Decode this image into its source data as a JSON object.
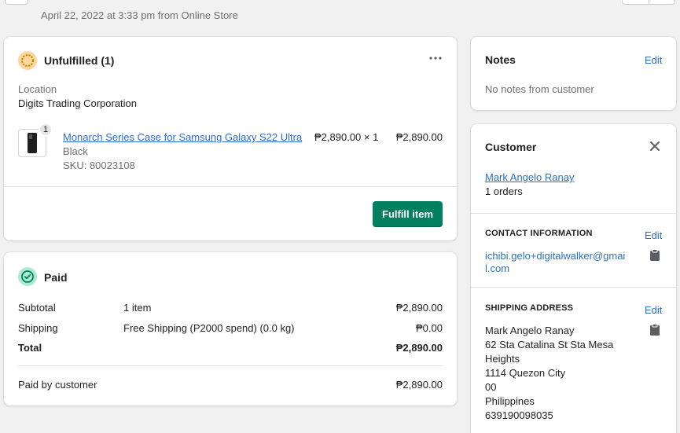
{
  "header": {
    "subtitle": "April 22, 2022 at 3:33 pm from Online Store"
  },
  "fulfillment": {
    "title": "Unfulfilled (1)",
    "more_icon": "more-horizontal-icon",
    "location_label": "Location",
    "location_value": "Digits Trading Corporation",
    "item": {
      "quantity_badge": "1",
      "name": "Monarch Series Case for Samsung Galaxy S22 Ultra",
      "variant": "Black",
      "sku": "SKU: 80023108",
      "unit_price": "₱2,890.00 × 1",
      "line_total": "₱2,890.00"
    },
    "fulfill_button": "Fulfill item",
    "status_color": "#ffd79d"
  },
  "payment": {
    "title": "Paid",
    "status_color": "#aee9d1",
    "rows": [
      {
        "label": "Subtotal",
        "detail": "1 item",
        "amount": "₱2,890.00"
      },
      {
        "label": "Shipping",
        "detail": "Free Shipping (P2000 spend) (0.0 kg)",
        "amount": "₱0.00"
      }
    ],
    "total_label": "Total",
    "total_amount": "₱2,890.00",
    "paid_by_label": "Paid by customer",
    "paid_by_amount": "₱2,890.00"
  },
  "notes": {
    "title": "Notes",
    "edit": "Edit",
    "body": "No notes from customer"
  },
  "customer": {
    "title": "Customer",
    "close_icon": "close-icon",
    "name": "Mark Angelo Ranay",
    "orders": "1 orders",
    "contact": {
      "heading": "CONTACT INFORMATION",
      "edit": "Edit",
      "email_line1": "ichibi.gelo+digitalwalker@gmai",
      "email_line2": "l.com"
    },
    "shipping": {
      "heading": "SHIPPING ADDRESS",
      "edit": "Edit",
      "lines": [
        "Mark Angelo Ranay",
        "62 Sta Catalina St Sta Mesa",
        "Heights",
        "1114 Quezon City",
        "00",
        "Philippines",
        "639190098035"
      ]
    }
  },
  "colors": {
    "primary_button": "#008060",
    "link": "#2c6ecb"
  }
}
